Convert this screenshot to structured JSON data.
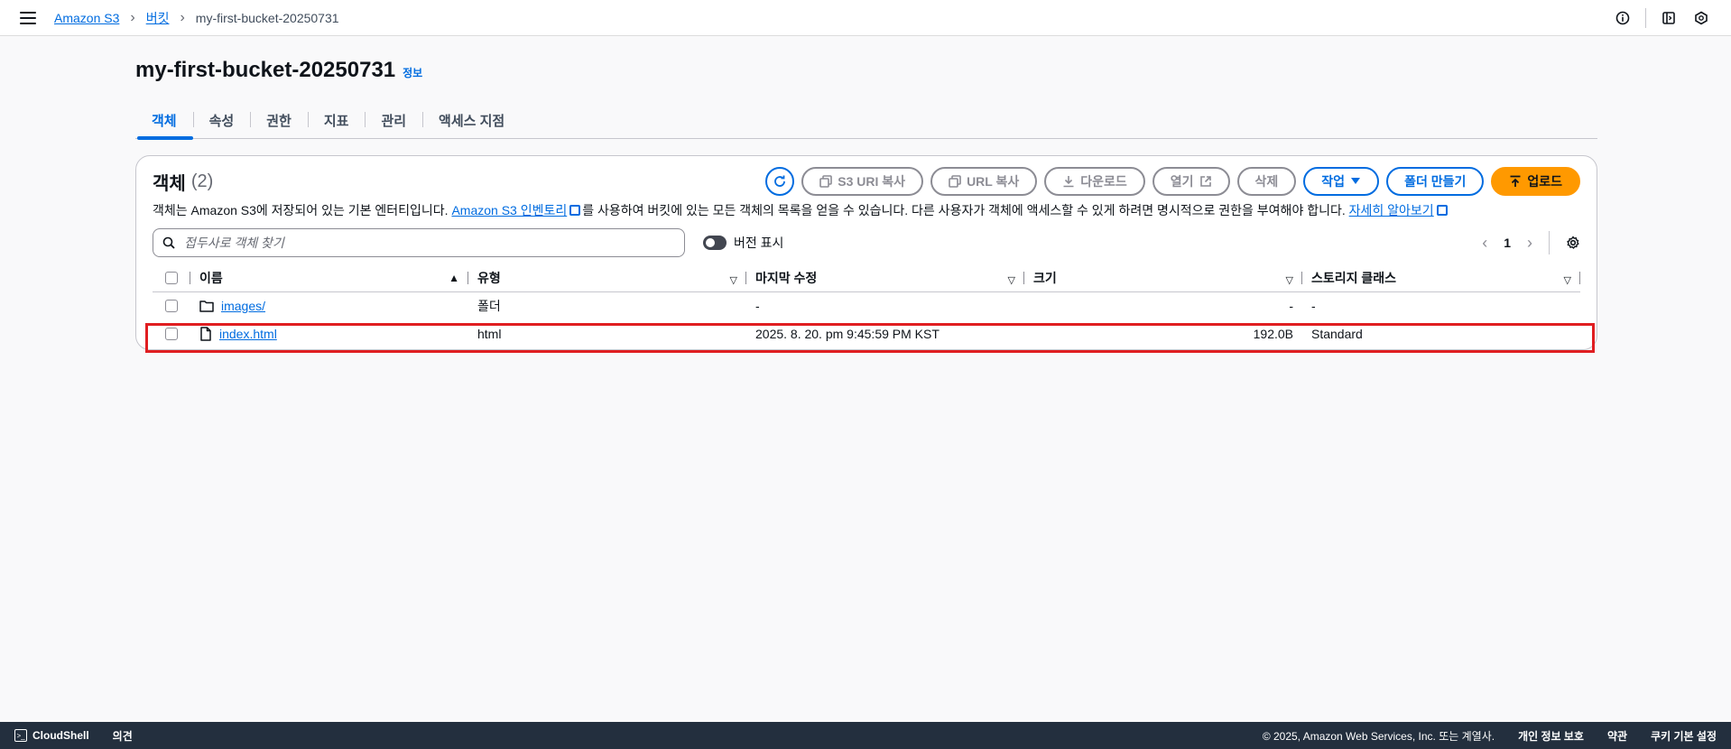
{
  "breadcrumb": {
    "items": [
      "Amazon S3",
      "버킷"
    ],
    "current": "my-first-bucket-20250731"
  },
  "page": {
    "title": "my-first-bucket-20250731",
    "info": "정보"
  },
  "tabs": [
    "객체",
    "속성",
    "권한",
    "지표",
    "관리",
    "액세스 지점"
  ],
  "panel": {
    "title": "객체",
    "count": "(2)",
    "buttons": {
      "copy_s3_uri": "S3 URI 복사",
      "copy_url": "URL 복사",
      "download": "다운로드",
      "open": "열기",
      "delete": "삭제",
      "actions": "작업",
      "create_folder": "폴더 만들기",
      "upload": "업로드"
    },
    "description": {
      "part1": "객체는 Amazon S3에 저장되어 있는 기본 엔터티입니다.",
      "link1": "Amazon S3 인벤토리",
      "part2": "를 사용하여 버킷에 있는 모든 객체의 목록을 얻을 수 있습니다. 다른 사용자가 객체에 액세스할 수 있게 하려면 명시적으로 권한을 부여해야 합니다.",
      "link2": "자세히 알아보기"
    },
    "search_placeholder": "접두사로 객체 찾기",
    "toggle_label": "버전 표시",
    "page_number": "1"
  },
  "table": {
    "columns": [
      "이름",
      "유형",
      "마지막 수정",
      "크기",
      "스토리지 클래스"
    ],
    "rows": [
      {
        "name": "images/",
        "type": "폴더",
        "modified": "-",
        "size": "-",
        "storage": "-",
        "icon": "folder-icon"
      },
      {
        "name": "index.html",
        "type": "html",
        "modified": "2025. 8. 20. pm 9:45:59 PM KST",
        "size": "192.0B",
        "storage": "Standard",
        "icon": "file-icon"
      }
    ]
  },
  "footer": {
    "cloudshell": "CloudShell",
    "feedback": "의견",
    "copyright": "© 2025, Amazon Web Services, Inc. 또는 계열사.",
    "privacy": "개인 정보 보호",
    "terms": "약관",
    "cookies": "쿠키 기본 설정"
  },
  "colors": {
    "accent": "#006ce0",
    "upload": "#ff9900",
    "highlight": "#e01e21",
    "footer_bg": "#232f3e"
  }
}
